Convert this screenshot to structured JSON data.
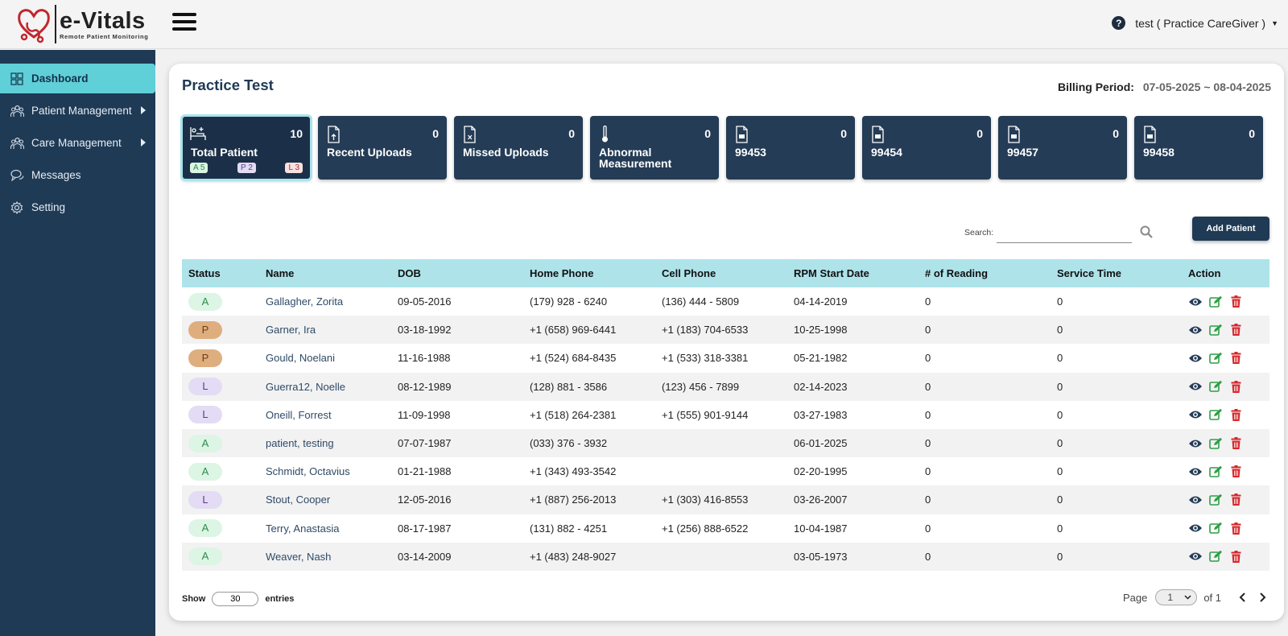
{
  "header": {
    "logo_name": "e-Vitals",
    "logo_tagline": "Remote Patient Monitoring",
    "user_label": "test ( Practice CareGiver )"
  },
  "sidebar": {
    "items": [
      {
        "label": "Dashboard",
        "icon": "dashboard-icon",
        "active": true
      },
      {
        "label": "Patient Management",
        "icon": "people-icon",
        "has_submenu": true
      },
      {
        "label": "Care Management",
        "icon": "people-icon",
        "has_submenu": true
      },
      {
        "label": "Messages",
        "icon": "chat-icon"
      },
      {
        "label": "Setting",
        "icon": "gear-icon"
      }
    ]
  },
  "main": {
    "title": "Practice Test",
    "billing_label": "Billing Period:",
    "billing_value": "07-05-2025 ~ 08-04-2025",
    "tiles": [
      {
        "label": "Total Patient",
        "count": "10",
        "icon": "bed-icon",
        "badges": [
          {
            "text": "A 5",
            "color": "#dcf5e4",
            "fg": "#2e8b4c"
          },
          {
            "text": "P 2",
            "color": "#e3dcf4",
            "fg": "#5b3c8e"
          },
          {
            "text": "L 3",
            "color": "#f8e0e0",
            "fg": "#9a3030"
          }
        ]
      },
      {
        "label": "Recent Uploads",
        "count": "0",
        "icon": "file-upload-icon"
      },
      {
        "label": "Missed Uploads",
        "count": "0",
        "icon": "file-missed-icon"
      },
      {
        "label": "Abnormal Measurement",
        "count": "0",
        "icon": "thermometer-icon"
      },
      {
        "label": "99453",
        "count": "0",
        "icon": "document-icon"
      },
      {
        "label": "99454",
        "count": "0",
        "icon": "document-icon"
      },
      {
        "label": "99457",
        "count": "0",
        "icon": "document-icon"
      },
      {
        "label": "99458",
        "count": "0",
        "icon": "document-icon"
      }
    ],
    "search_label": "Search:",
    "search_value": "",
    "add_button": "Add Patient"
  },
  "table": {
    "columns": [
      "Status",
      "Name",
      "DOB",
      "Home Phone",
      "Cell Phone",
      "RPM Start Date",
      "# of Reading",
      "Service Time",
      "Action"
    ],
    "rows": [
      {
        "status": "A",
        "name": "Gallagher, Zorita",
        "dob": "09-05-2016",
        "home": "(179) 928 - 6240",
        "cell": "(136) 444 - 5809",
        "start": "04-14-2019",
        "reading": "0",
        "service": "0"
      },
      {
        "status": "P",
        "name": "Garner, Ira",
        "dob": "03-18-1992",
        "home": "+1 (658) 969-6441",
        "cell": "+1 (183) 704-6533",
        "start": "10-25-1998",
        "reading": "0",
        "service": "0"
      },
      {
        "status": "P",
        "name": "Gould, Noelani",
        "dob": "11-16-1988",
        "home": "+1 (524) 684-8435",
        "cell": "+1 (533) 318-3381",
        "start": "05-21-1982",
        "reading": "0",
        "service": "0"
      },
      {
        "status": "L",
        "name": "Guerra12, Noelle",
        "dob": "08-12-1989",
        "home": "(128) 881 - 3586",
        "cell": "(123) 456 - 7899",
        "start": "02-14-2023",
        "reading": "0",
        "service": "0"
      },
      {
        "status": "L",
        "name": "Oneill, Forrest",
        "dob": "11-09-1998",
        "home": "+1 (518) 264-2381",
        "cell": "+1 (555) 901-9144",
        "start": "03-27-1983",
        "reading": "0",
        "service": "0"
      },
      {
        "status": "A",
        "name": "patient, testing",
        "dob": "07-07-1987",
        "home": "(033) 376 - 3932",
        "cell": "",
        "start": "06-01-2025",
        "reading": "0",
        "service": "0"
      },
      {
        "status": "A",
        "name": "Schmidt, Octavius",
        "dob": "01-21-1988",
        "home": "+1 (343) 493-3542",
        "cell": "",
        "start": "02-20-1995",
        "reading": "0",
        "service": "0"
      },
      {
        "status": "L",
        "name": "Stout, Cooper",
        "dob": "12-05-2016",
        "home": "+1 (887) 256-2013",
        "cell": "+1 (303) 416-8553",
        "start": "03-26-2007",
        "reading": "0",
        "service": "0"
      },
      {
        "status": "A",
        "name": "Terry, Anastasia",
        "dob": "08-17-1987",
        "home": "(131) 882 - 4251",
        "cell": "+1 (256) 888-6522",
        "start": "10-04-1987",
        "reading": "0",
        "service": "0"
      },
      {
        "status": "A",
        "name": "Weaver, Nash",
        "dob": "03-14-2009",
        "home": "+1 (483) 248-9027",
        "cell": "",
        "start": "03-05-1973",
        "reading": "0",
        "service": "0"
      }
    ]
  },
  "footer": {
    "show_label": "Show",
    "entries_value": "30",
    "entries_label": "entries",
    "page_label": "Page",
    "page_value": "1",
    "of_label": "of 1"
  },
  "colors": {
    "sidebar_bg": "#1f3a55",
    "sidebar_active": "#5fcfd8",
    "tile_bg": "#243c56",
    "table_header": "#aee3ea",
    "edit_green": "#2e9e46",
    "delete_red": "#d7262b"
  }
}
